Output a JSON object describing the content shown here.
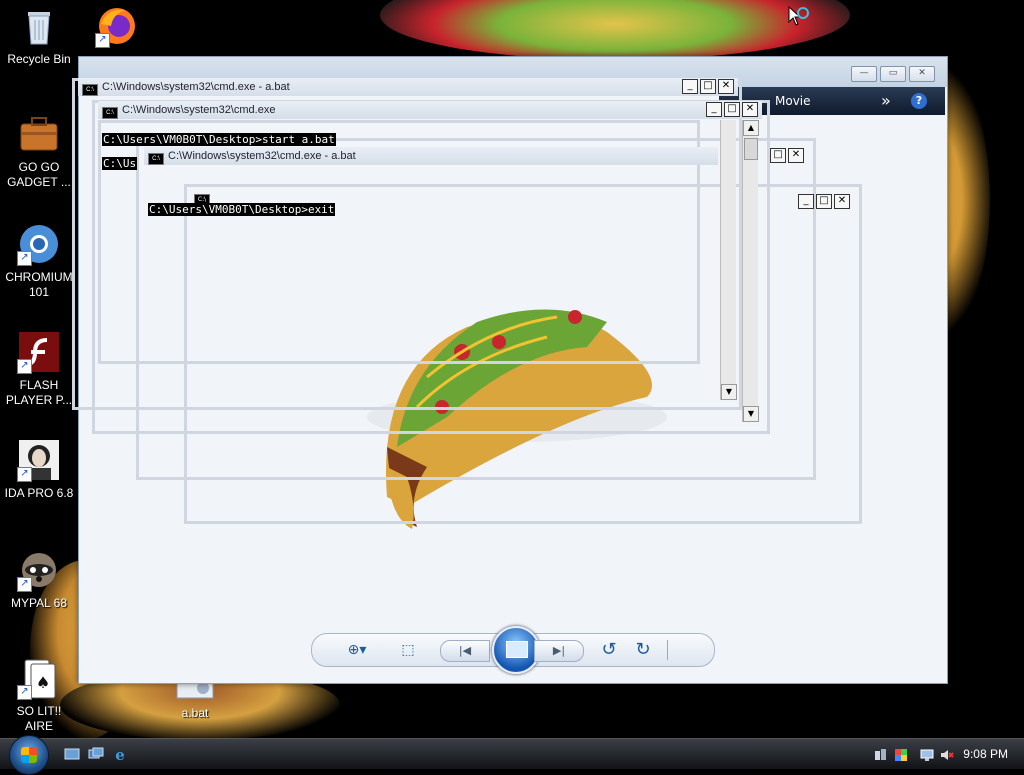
{
  "desktop": {
    "icons": [
      {
        "label": "Recycle Bin"
      },
      {
        "label": "GO GO GADGET ..."
      },
      {
        "label": "CHROMIUM 101"
      },
      {
        "label": "FLASH PLAYER P..."
      },
      {
        "label": "IDA PRO 6.8"
      },
      {
        "label": "MYPAL 68"
      },
      {
        "label": "SO LIT!! AIRE"
      },
      {
        "label": "a.bat"
      }
    ]
  },
  "viewer": {
    "menu_label": "Movie",
    "menu_more": "»",
    "help": "?",
    "toolbar": {
      "zoom": "⊕▾",
      "fit": "⬚",
      "prev": "|◀",
      "next": "▶|",
      "rotate_ccw": "↺",
      "rotate_cw": "↻"
    }
  },
  "cmd": {
    "window1_title": "C:\\Windows\\system32\\cmd.exe - a.bat",
    "window2_title": "C:\\Windows\\system32\\cmd.exe",
    "window3_title": "C:\\Windows\\system32\\cmd.exe - a.bat",
    "line_start": "C:\\Users\\VM0B0T\\Desktop>start a.bat",
    "line_partial": "C:\\Us",
    "line_exit": "C:\\Users\\VM0B0T\\Desktop>exit"
  },
  "taskbar": {
    "clock": "9:08 PM"
  },
  "colors": {
    "accent": "#1f5aa0",
    "cmd_bg": "#000000",
    "taco_shell": "#d9a53c"
  }
}
